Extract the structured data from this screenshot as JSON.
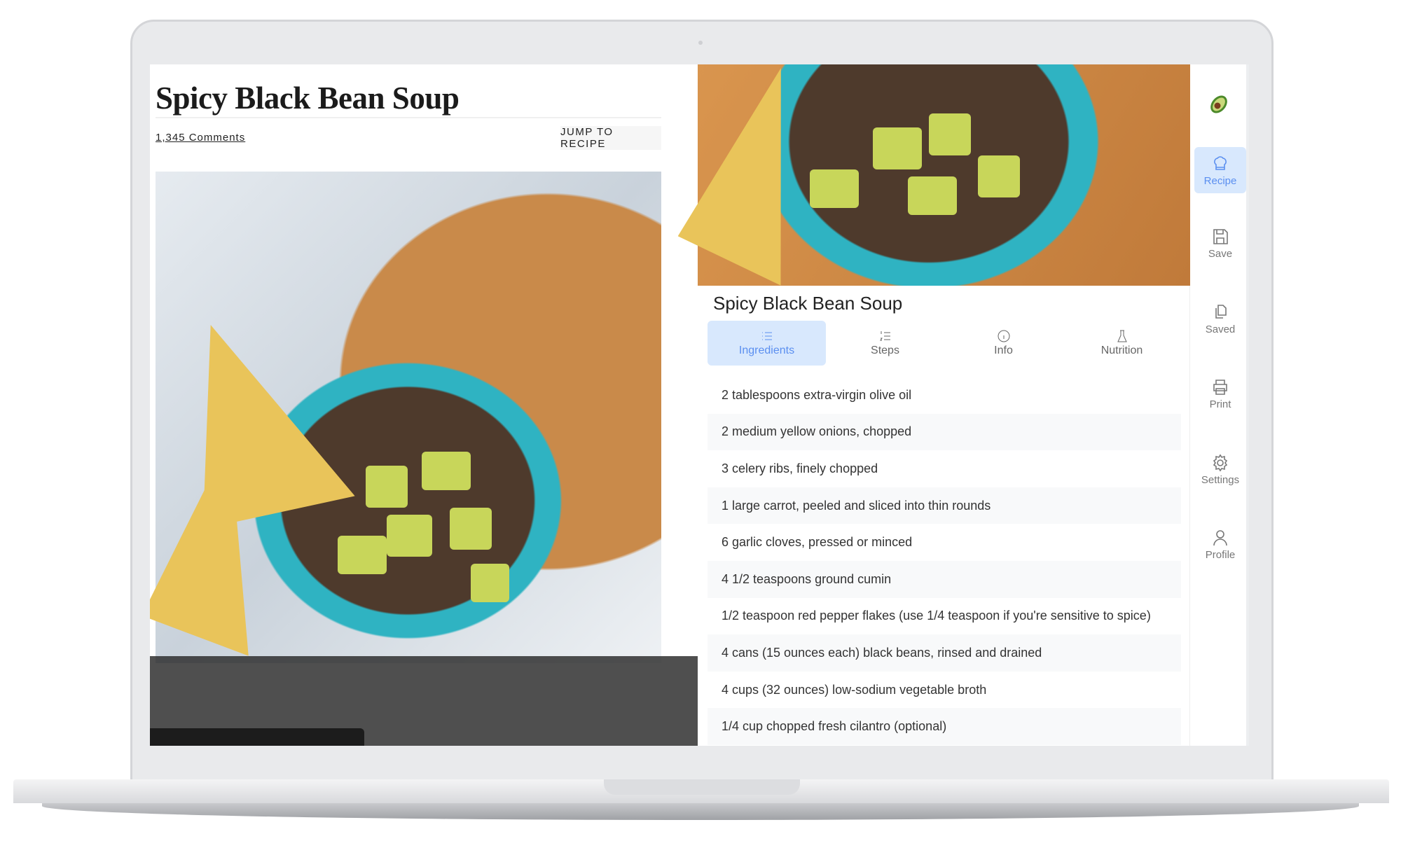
{
  "left": {
    "title": "Spicy Black Bean Soup",
    "comments": "1,345 Comments",
    "jump_label": "JUMP TO RECIPE"
  },
  "recipe": {
    "title": "Spicy Black Bean Soup",
    "tabs": [
      {
        "label": "Ingredients",
        "icon": "list-icon",
        "active": true
      },
      {
        "label": "Steps",
        "icon": "numbered-list-icon"
      },
      {
        "label": "Info",
        "icon": "info-icon"
      },
      {
        "label": "Nutrition",
        "icon": "flask-icon"
      }
    ],
    "ingredients": [
      "2 tablespoons extra-virgin olive oil",
      "2 medium yellow onions, chopped",
      "3 celery ribs, finely chopped",
      "1 large carrot, peeled and sliced into thin rounds",
      "6 garlic cloves, pressed or minced",
      "4 1/2 teaspoons ground cumin",
      "1/2 teaspoon red pepper flakes (use 1/4 teaspoon if you're sensitive to spice)",
      "4 cans (15 ounces each) black beans, rinsed and drained",
      "4 cups (32 ounces) low-sodium vegetable broth",
      "1/4 cup chopped fresh cilantro (optional)"
    ]
  },
  "sidebar": {
    "logo": "avocado-logo",
    "items": [
      {
        "label": "Recipe",
        "icon": "chef-hat-icon",
        "active": true
      },
      {
        "label": "Save",
        "icon": "save-icon"
      },
      {
        "label": "Saved",
        "icon": "copy-icon"
      },
      {
        "label": "Print",
        "icon": "printer-icon"
      },
      {
        "label": "Settings",
        "icon": "gear-icon"
      },
      {
        "label": "Profile",
        "icon": "user-icon"
      }
    ]
  },
  "colors": {
    "accent": "#5b8ff0",
    "accent_bg": "#d8e8fd"
  }
}
